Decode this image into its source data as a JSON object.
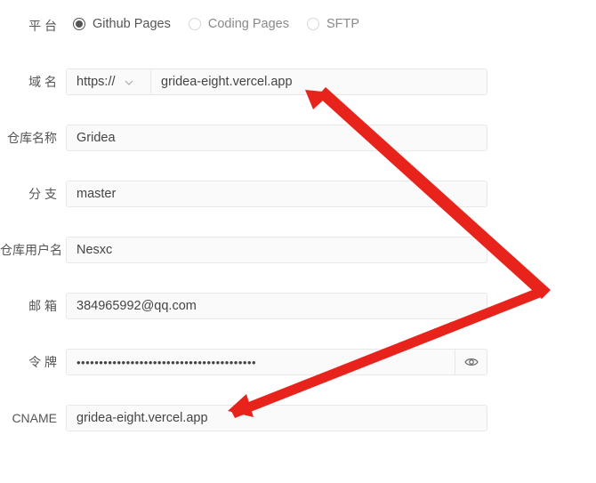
{
  "platform": {
    "label": "平 台",
    "options": [
      "Github Pages",
      "Coding Pages",
      "SFTP"
    ],
    "selected": "Github Pages"
  },
  "domain": {
    "label": "域 名",
    "protocol": "https://",
    "value": "gridea-eight.vercel.app"
  },
  "repository": {
    "label": "仓库名称",
    "value": "Gridea"
  },
  "branch": {
    "label": "分 支",
    "value": "master"
  },
  "username": {
    "label": "仓库用户名",
    "value": "Nesxc"
  },
  "email": {
    "label": "邮 箱",
    "value": "384965992@qq.com"
  },
  "token": {
    "label": "令 牌",
    "masked_value": "••••••••••••••••••••••••••••••••••••••••"
  },
  "cname": {
    "label": "CNAME",
    "value": "gridea-eight.vercel.app"
  },
  "colors": {
    "annotation_arrow": "#e8231c",
    "radio_checked": "#555555",
    "field_bg": "#fafafa"
  },
  "icons": {
    "protocol_dropdown": "chevron-down-icon",
    "token_toggle": "eye-icon"
  }
}
